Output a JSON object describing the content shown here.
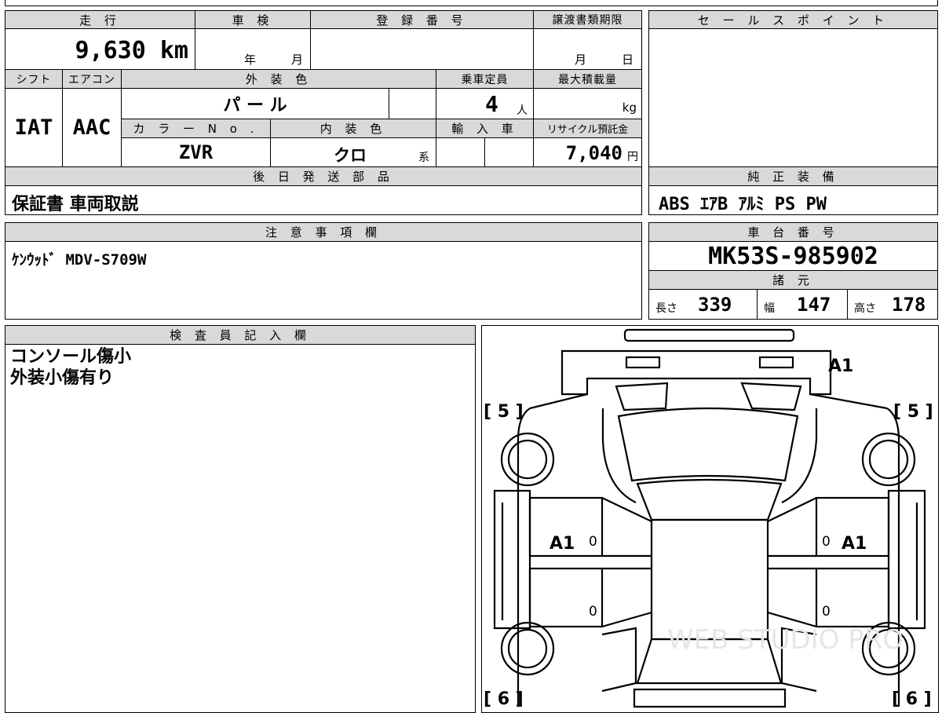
{
  "mileage": {
    "label": "走 行",
    "value": "9,630 km"
  },
  "shaken": {
    "label": "車 検",
    "year_unit": "年",
    "month_unit": "月"
  },
  "registration": {
    "label": "登 録 番 号",
    "value": ""
  },
  "transfer_deadline": {
    "label": "譲渡書類期限",
    "month_unit": "月",
    "day_unit": "日"
  },
  "sales_point": {
    "label": "セ ー ル ス ポ イ ン ト",
    "value": ""
  },
  "shift": {
    "label": "シフト",
    "value": "IAT"
  },
  "aircon": {
    "label": "エアコン",
    "value": "AAC"
  },
  "exterior_color": {
    "label": "外 装 色",
    "value": "パ ー ル"
  },
  "capacity": {
    "label": "乗車定員",
    "value": "4",
    "unit": "人"
  },
  "max_load": {
    "label": "最大積載量",
    "unit": "kg"
  },
  "color_no": {
    "label": "カ ラ ー N o .",
    "value": "ZVR"
  },
  "interior_color": {
    "label": "内 装 色",
    "value": "クロ",
    "suffix": "系"
  },
  "import": {
    "label": "輸 入 車"
  },
  "recycle": {
    "label": "リサイクル預託金",
    "value": "7,040",
    "unit": "円"
  },
  "later_shipping": {
    "label": "後 日 発 送 部 品",
    "value": "保証書 車両取説"
  },
  "genuine_equipment": {
    "label": "純 正 装 備",
    "value": "ABS ｴｱB ｱﾙﾐ PS PW"
  },
  "notes": {
    "label": "注 意 事 項 欄",
    "value": "ｹﾝｳｯﾄﾞ MDV-S709W"
  },
  "chassis": {
    "label": "車 台 番 号",
    "value": "MK53S-985902"
  },
  "specs": {
    "label": "諸 元",
    "length_label": "長さ",
    "length": "339",
    "width_label": "幅",
    "width": "147",
    "height_label": "高さ",
    "height": "178"
  },
  "inspector": {
    "label": "検 査 員 記 入 欄",
    "line1": "コンソール傷小",
    "line2": "外装小傷有り"
  },
  "diagram": {
    "mark_front": "A1",
    "mark_left_door": "A1",
    "mark_right_door": "A1",
    "score_front_left": "[ 5 ]",
    "score_front_right": "[ 5 ]",
    "score_rear_left": "[ 6 ]",
    "score_rear_right": "[ 6 ]",
    "zero": "0",
    "watermark": "WEB STUDIO PRO"
  }
}
